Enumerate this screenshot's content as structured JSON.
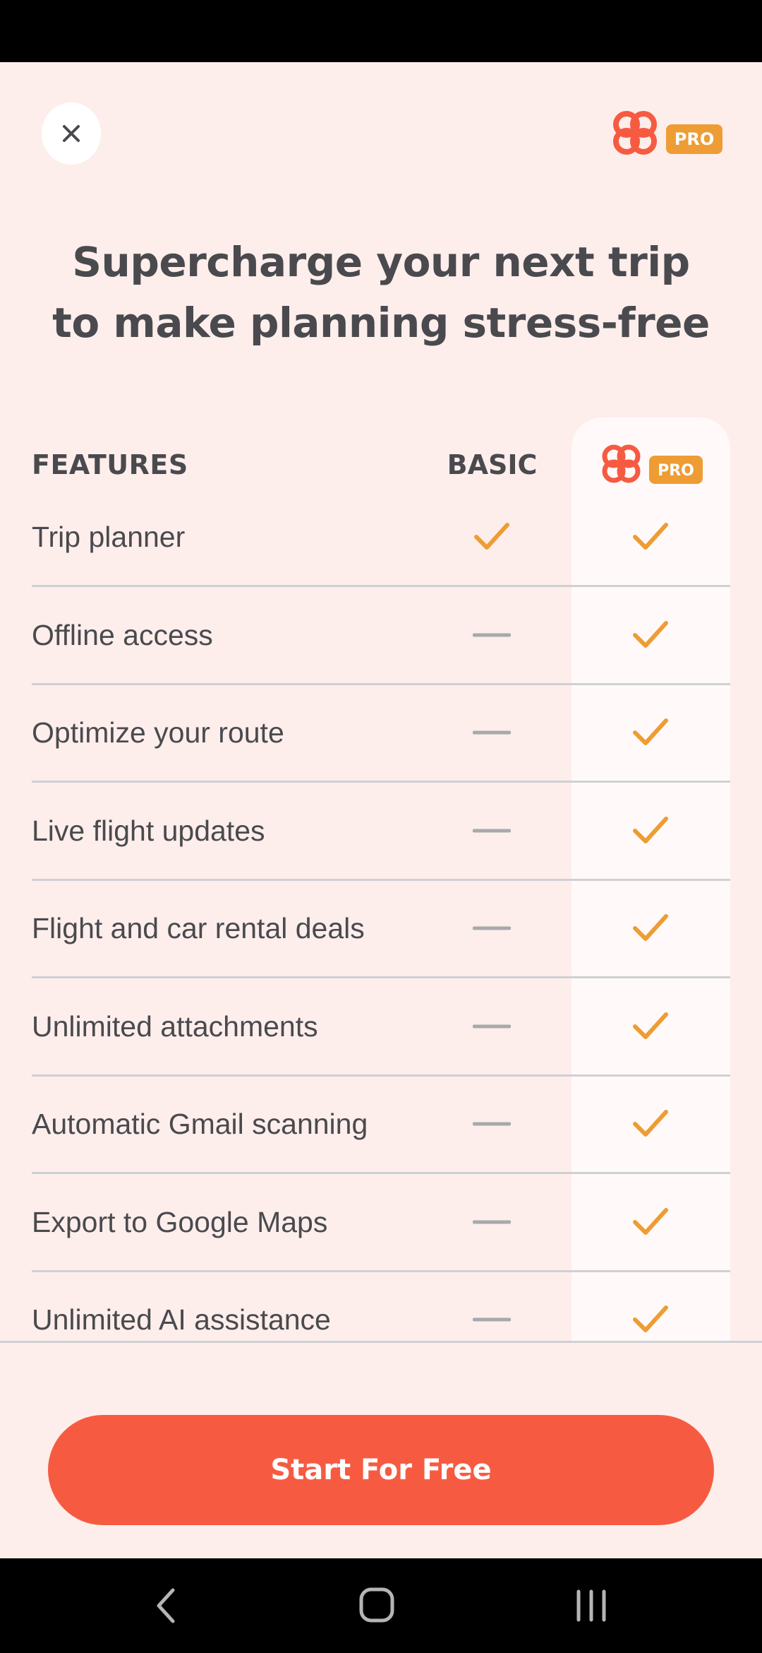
{
  "colors": {
    "background": "#fdeeec",
    "pro_column": "#fffaf9",
    "accent_check": "#ee9c34",
    "dash": "#a8a9ad",
    "brand_red": "#f65b42",
    "pro_badge": "#ee9c34",
    "text": "#4a4a4e"
  },
  "header": {
    "close_icon": "close-icon",
    "logo_badge": "PRO"
  },
  "headline": {
    "line1": "Supercharge your next trip",
    "line2": "to make planning stress-free"
  },
  "table": {
    "features_label": "FEATURES",
    "basic_label": "BASIC",
    "pro_badge": "PRO",
    "rows": [
      {
        "label": "Trip planner",
        "basic": "check",
        "pro": "check"
      },
      {
        "label": "Offline access",
        "basic": "dash",
        "pro": "check"
      },
      {
        "label": "Optimize your route",
        "basic": "dash",
        "pro": "check"
      },
      {
        "label": "Live flight updates",
        "basic": "dash",
        "pro": "check"
      },
      {
        "label": "Flight and car rental deals",
        "basic": "dash",
        "pro": "check"
      },
      {
        "label": "Unlimited attachments",
        "basic": "dash",
        "pro": "check"
      },
      {
        "label": "Automatic Gmail scanning",
        "basic": "dash",
        "pro": "check"
      },
      {
        "label": "Export to Google Maps",
        "basic": "dash",
        "pro": "check"
      },
      {
        "label": "Unlimited AI assistance",
        "basic": "dash",
        "pro": "check"
      }
    ]
  },
  "cta": {
    "label": "Start For Free"
  },
  "navbar": {
    "back_icon": "back-icon",
    "home_icon": "home-icon",
    "recents_icon": "recents-icon"
  }
}
